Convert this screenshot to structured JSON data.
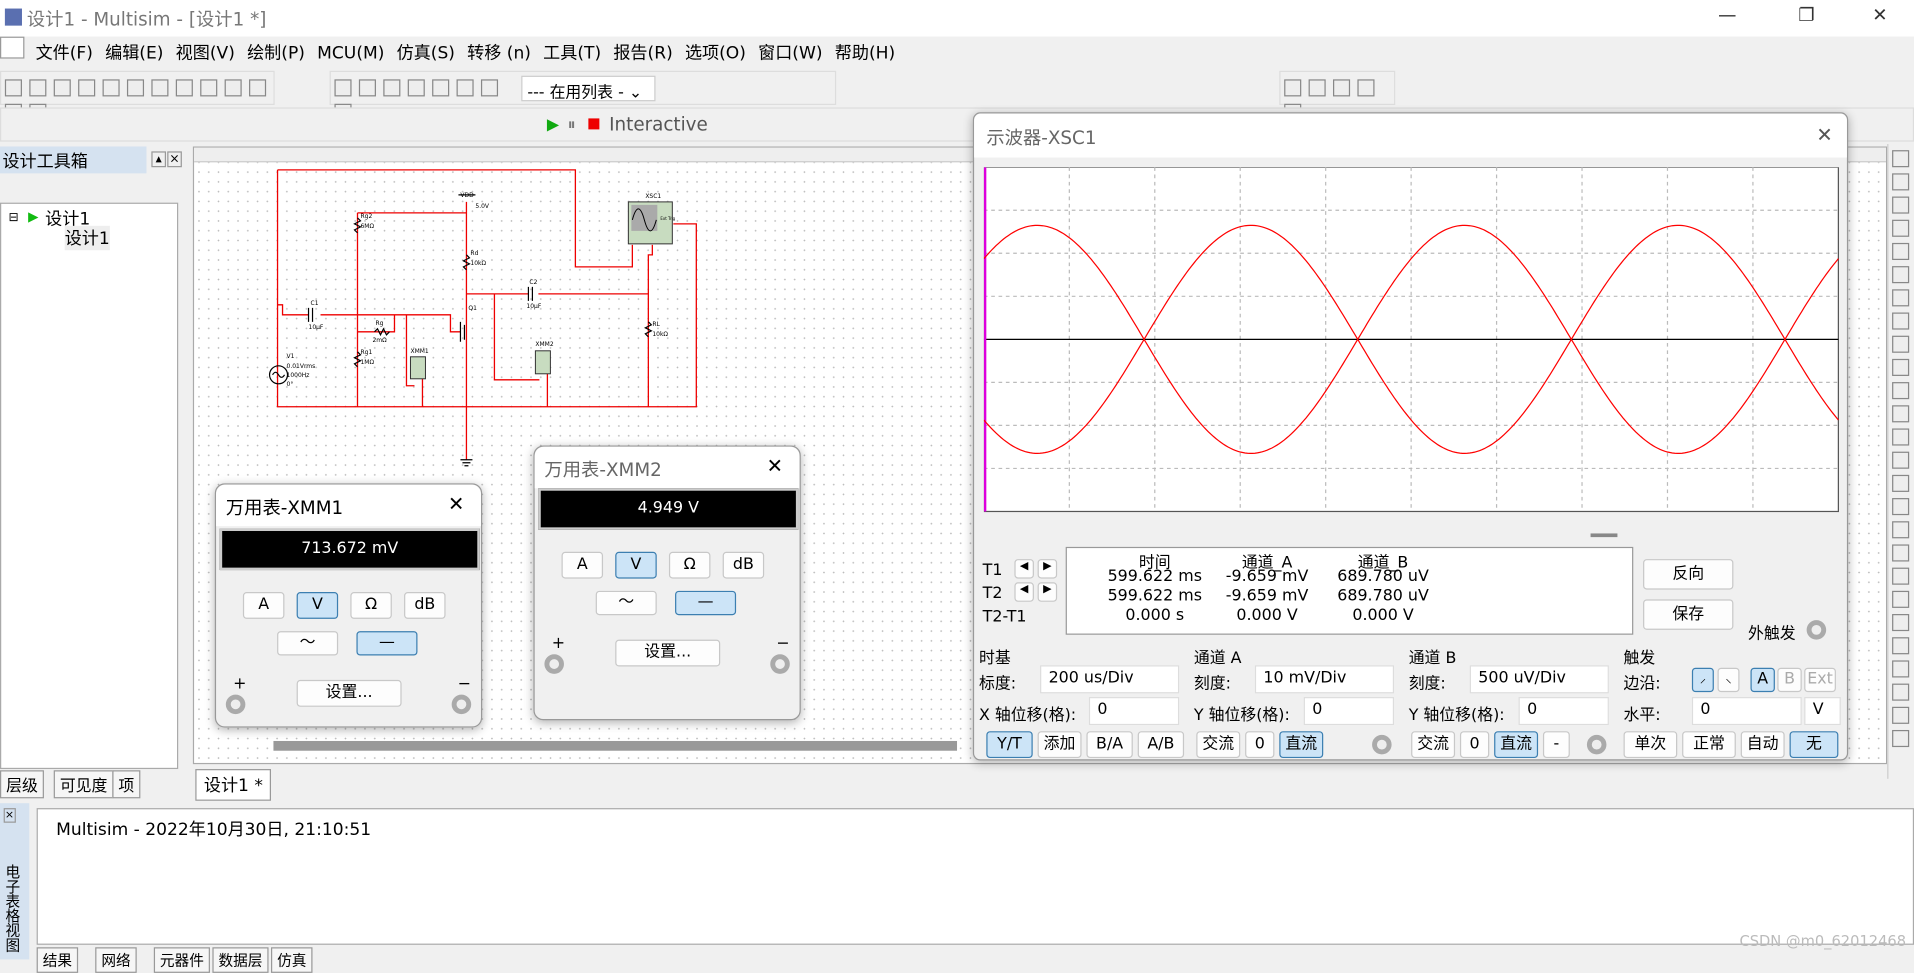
{
  "window": {
    "title": "设计1 - Multisim - [设计1 *]",
    "min": "—",
    "restore": "❐",
    "close": "✕"
  },
  "menu": [
    "文件(F)",
    "编辑(E)",
    "视图(V)",
    "绘制(P)",
    "MCU(M)",
    "仿真(S)",
    "转移 (n)",
    "工具(T)",
    "报告(R)",
    "选项(O)",
    "窗口(W)",
    "帮助(H)"
  ],
  "toolbar": {
    "in_use_list": "--- 在用列表 -",
    "interactive": "Interactive"
  },
  "design_toolbox": {
    "title": "设计工具箱",
    "tree_root": "设计1",
    "tree_child": "设计1",
    "tabs": [
      "层级",
      "可见度",
      "项"
    ]
  },
  "doc_tab": "设计1 *",
  "schematic": {
    "VDD": "VDD",
    "VDD_val": "5.0V",
    "Rg2": "Rg2",
    "Rg2_val": "6MΩ",
    "Rd": "Rd",
    "Rd_val": "10kΩ",
    "C1": "C1",
    "C1_val": "10µF",
    "C2": "C2",
    "C2_val": "10µF",
    "Rg": "Rg",
    "Rg_val": "2mΩ",
    "Rg1": "Rg1",
    "Rg1_val": "1MΩ",
    "Q1": "Q1",
    "V1": "V1",
    "V1_amp": "0.01Vrms",
    "V1_freq": "1000Hz",
    "V1_phase": "0°",
    "XMM1": "XMM1",
    "XMM2": "XMM2",
    "XSC1": "XSC1",
    "ext_trig": "Ext Trig",
    "RL": "RL",
    "RL_val": "10kΩ"
  },
  "xmm1": {
    "title": "万用表-XMM1",
    "reading": "713.672 mV",
    "modes": [
      "A",
      "V",
      "Ω",
      "dB"
    ],
    "active_mode": "V",
    "ac": "～",
    "dc": "—",
    "settings": "设置...",
    "plus": "+",
    "minus": "−"
  },
  "xmm2": {
    "title": "万用表-XMM2",
    "reading": "4.949 V",
    "modes": [
      "A",
      "V",
      "Ω",
      "dB"
    ],
    "active_mode": "V",
    "ac": "～",
    "dc": "—",
    "settings": "设置...",
    "plus": "+",
    "minus": "−"
  },
  "scope": {
    "title": "示波器-XSC1",
    "close": "✕",
    "cursor_headers": [
      "时间",
      "通道_A",
      "通道_B"
    ],
    "rows": [
      {
        "label": "T1",
        "time": "599.622 ms",
        "a": "-9.659 mV",
        "b": "689.780 uV"
      },
      {
        "label": "T2",
        "time": "599.622 ms",
        "a": "-9.659 mV",
        "b": "689.780 uV"
      },
      {
        "label": "T2-T1",
        "time": "0.000 s",
        "a": "0.000 V",
        "b": "0.000 V"
      }
    ],
    "reverse": "反向",
    "save": "保存",
    "ext_trigger": "外触发",
    "timebase": {
      "title": "时基",
      "scale_label": "标度:",
      "scale": "200 us/Div",
      "xpos_label": "X 轴位移(格):",
      "xpos": "0",
      "buttons": [
        "Y/T",
        "添加",
        "B/A",
        "A/B"
      ],
      "active": "Y/T"
    },
    "channel_a": {
      "title": "通道 A",
      "scale_label": "刻度:",
      "scale": "10 mV/Div",
      "ypos_label": "Y 轴位移(格):",
      "ypos": "0",
      "buttons": [
        "交流",
        "0",
        "直流"
      ],
      "active": "直流"
    },
    "channel_b": {
      "title": "通道 B",
      "scale_label": "刻度:",
      "scale": "500 uV/Div",
      "ypos_label": "Y 轴位移(格):",
      "ypos": "0",
      "buttons": [
        "交流",
        "0",
        "直流",
        "-"
      ],
      "active": "直流"
    },
    "trigger": {
      "title": "触发",
      "edge_label": "边沿:",
      "sources": [
        "A",
        "B",
        "Ext"
      ],
      "active_source": "A",
      "level_label": "水平:",
      "level": "0",
      "level_unit": "V",
      "modes": [
        "单次",
        "正常",
        "自动",
        "无"
      ],
      "active_mode": "无"
    }
  },
  "chart_data": {
    "type": "line",
    "grid": true,
    "x_divisions": 10,
    "y_divisions": 8,
    "time_per_div_us": 200,
    "trace_color": "#ff0000",
    "series": [
      {
        "frequency_hz": 1000,
        "amplitude_div": 2.65,
        "phase_deg": 45
      },
      {
        "frequency_hz": 1000,
        "amplitude_div": 2.65,
        "phase_deg": 225
      }
    ]
  },
  "log": {
    "text": "Multisim  -  2022年10月30日, 21:10:51",
    "side_label": "电子表格视图",
    "tabs": [
      "结果",
      "网络",
      "元器件",
      "数据层",
      "仿真"
    ]
  },
  "watermark": "CSDN @m0_62012468"
}
